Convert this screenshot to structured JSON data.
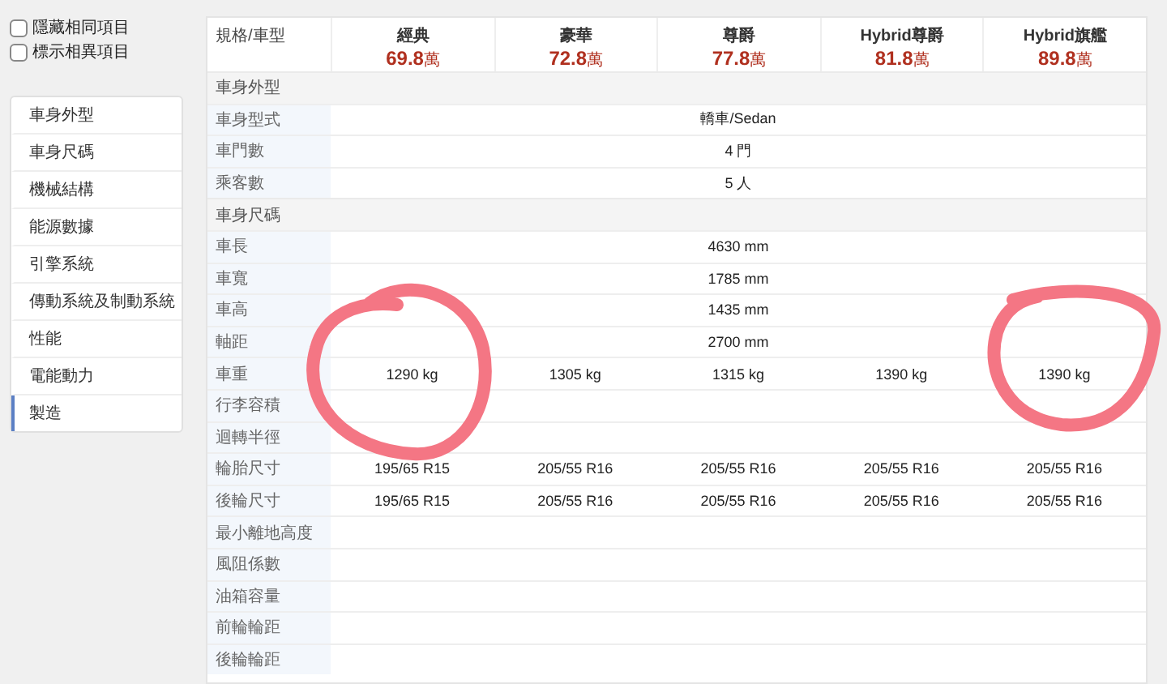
{
  "options": [
    {
      "label": "隱藏相同項目",
      "checked": false
    },
    {
      "label": "標示相異項目",
      "checked": false
    }
  ],
  "sidebar": {
    "items": [
      {
        "label": "車身外型",
        "selected": false
      },
      {
        "label": "車身尺碼",
        "selected": false
      },
      {
        "label": "機械結構",
        "selected": false
      },
      {
        "label": "能源數據",
        "selected": false
      },
      {
        "label": "引擎系統",
        "selected": false
      },
      {
        "label": "傳動系統及制動系統",
        "selected": false
      },
      {
        "label": "性能",
        "selected": false
      },
      {
        "label": "電能動力",
        "selected": false
      },
      {
        "label": "製造",
        "selected": true
      }
    ]
  },
  "table": {
    "corner": "規格/車型",
    "models": [
      {
        "name": "經典",
        "price": "69.8",
        "unit": "萬"
      },
      {
        "name": "豪華",
        "price": "72.8",
        "unit": "萬"
      },
      {
        "name": "尊爵",
        "price": "77.8",
        "unit": "萬"
      },
      {
        "name": "Hybrid尊爵",
        "price": "81.8",
        "unit": "萬"
      },
      {
        "name": "Hybrid旗艦",
        "price": "89.8",
        "unit": "萬"
      }
    ],
    "rows": [
      {
        "kind": "section",
        "label": "車身外型"
      },
      {
        "kind": "spec",
        "label": "車身型式",
        "cells": [
          "轎車/Sedan"
        ]
      },
      {
        "kind": "spec",
        "label": "車門數",
        "cells": [
          "4 門"
        ]
      },
      {
        "kind": "spec",
        "label": "乘客數",
        "cells": [
          "5 人"
        ]
      },
      {
        "kind": "section",
        "label": "車身尺碼"
      },
      {
        "kind": "spec",
        "label": "車長",
        "cells": [
          "4630 mm"
        ]
      },
      {
        "kind": "spec",
        "label": "車寬",
        "cells": [
          "1785 mm"
        ]
      },
      {
        "kind": "spec",
        "label": "車高",
        "cells": [
          "1435 mm"
        ]
      },
      {
        "kind": "spec",
        "label": "軸距",
        "cells": [
          "2700 mm"
        ]
      },
      {
        "kind": "spec",
        "label": "車重",
        "cells": [
          "1290 kg",
          "1305 kg",
          "1315 kg",
          "1390 kg",
          "1390 kg"
        ]
      },
      {
        "kind": "spec",
        "label": "行李容積"
      },
      {
        "kind": "spec",
        "label": "迴轉半徑"
      },
      {
        "kind": "spec",
        "label": "輪胎尺寸",
        "cells": [
          "195/65 R15",
          "205/55 R16",
          "205/55 R16",
          "205/55 R16",
          "205/55 R16"
        ]
      },
      {
        "kind": "spec",
        "label": "後輪尺寸",
        "cells": [
          "195/65 R15",
          "205/55 R16",
          "205/55 R16",
          "205/55 R16",
          "205/55 R16"
        ]
      },
      {
        "kind": "spec",
        "label": "最小離地高度"
      },
      {
        "kind": "spec",
        "label": "風阻係數"
      },
      {
        "kind": "spec",
        "label": "油箱容量"
      },
      {
        "kind": "spec",
        "label": "前輪輪距"
      },
      {
        "kind": "spec",
        "label": "後輪輪距"
      }
    ]
  }
}
